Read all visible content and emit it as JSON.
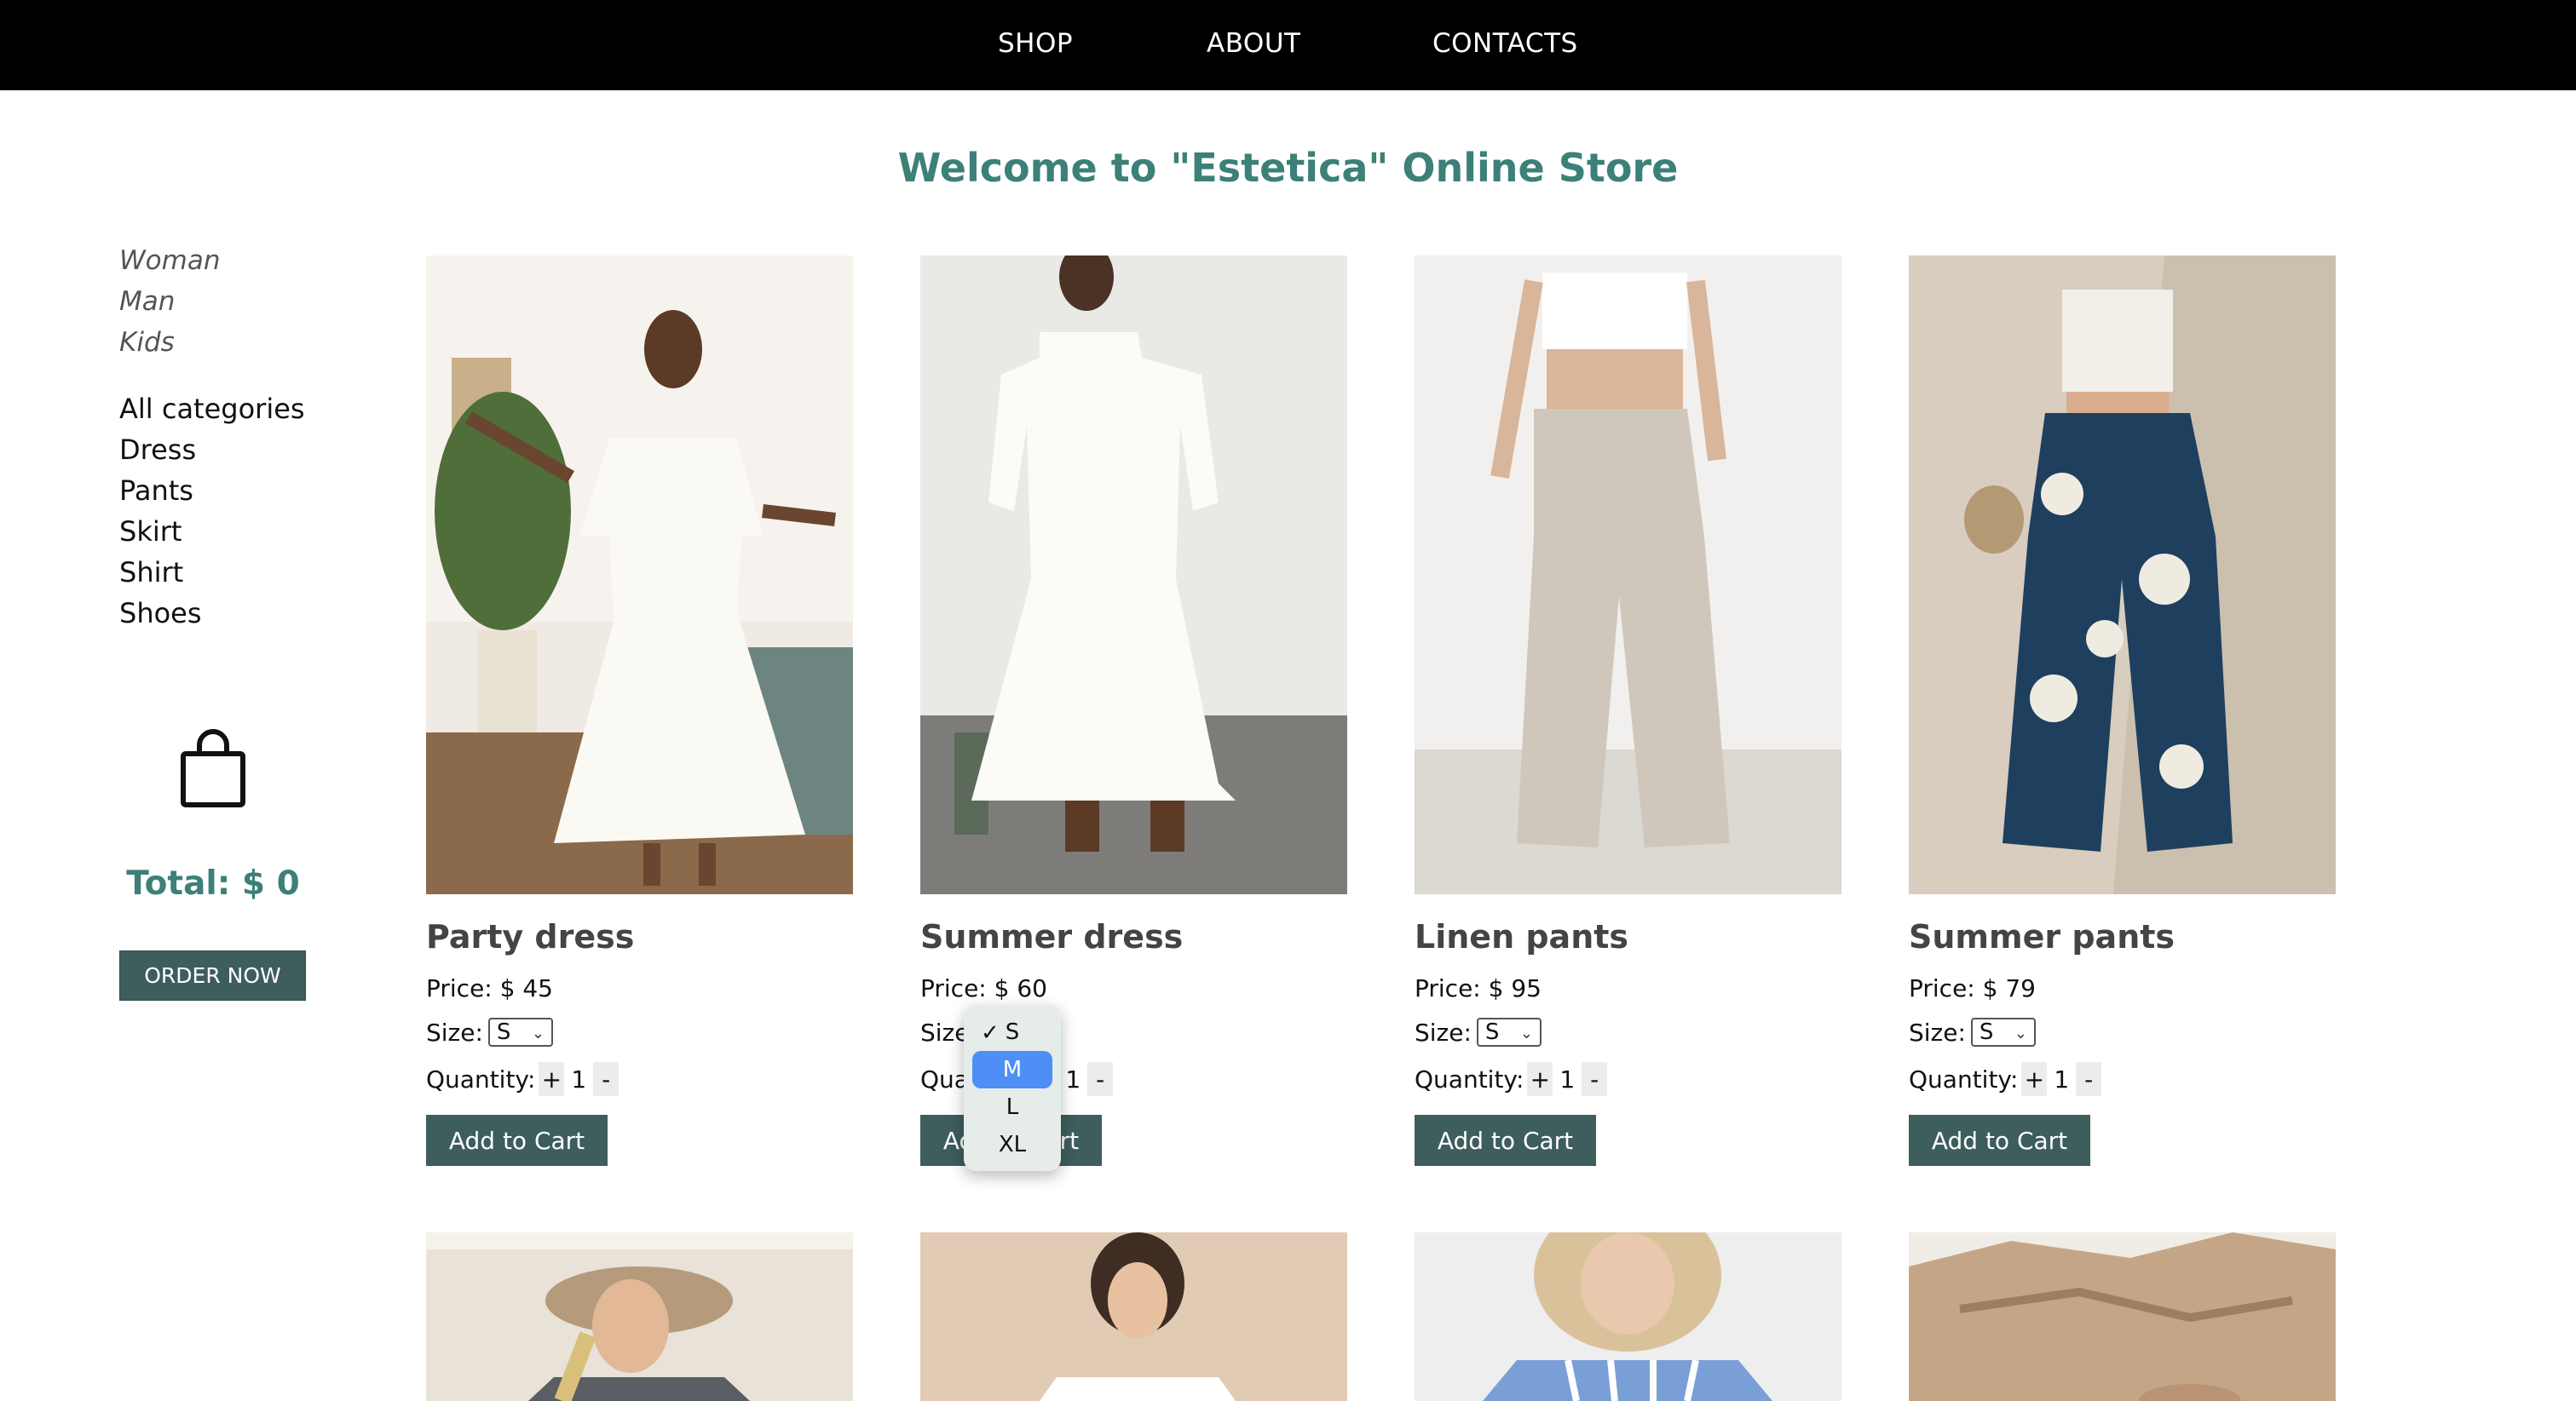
{
  "nav": {
    "items": [
      "SHOP",
      "ABOUT",
      "CONTACTS"
    ]
  },
  "welcome": "Welcome to \"Estetica\" Online Store",
  "sidebar": {
    "genders": [
      "Woman",
      "Man",
      "Kids"
    ],
    "categories": [
      "All categories",
      "Dress",
      "Pants",
      "Skirt",
      "Shirt",
      "Shoes"
    ],
    "total": "Total: $ 0",
    "order_label": "ORDER NOW"
  },
  "labels": {
    "size": "Size:",
    "quantity": "Quantity:",
    "plus": "+",
    "minus": "-",
    "add_to_cart": "Add to Cart"
  },
  "products": [
    {
      "name": "Party dress",
      "price": "Price: $ 45",
      "size": "S",
      "qty": "1"
    },
    {
      "name": "Summer dress",
      "price": "Price: $ 60",
      "size": "S",
      "qty": "1"
    },
    {
      "name": "Linen pants",
      "price": "Price: $ 95",
      "size": "S",
      "qty": "1"
    },
    {
      "name": "Summer pants",
      "price": "Price: $ 79",
      "size": "S",
      "qty": "1"
    }
  ],
  "size_dropdown": {
    "options": [
      "S",
      "M",
      "L",
      "XL"
    ],
    "selected": "S",
    "highlighted": "M",
    "check_mark": "✓"
  },
  "colors": {
    "accent": "#3c8078",
    "button": "#3e5d5d",
    "highlight": "#4d8ff5"
  }
}
